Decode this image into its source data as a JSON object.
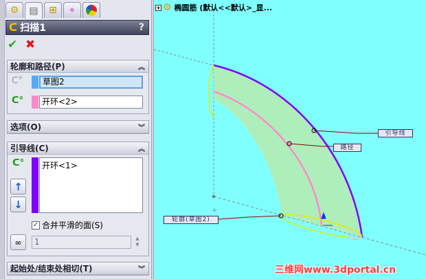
{
  "panel": {
    "tabs": [
      "feature-manager",
      "property-manager",
      "configuration-manager",
      "dimxpert-manager",
      "display-manager"
    ],
    "title": "扫描1",
    "help": "?",
    "ok_icon": "✔",
    "cancel_icon": "✖",
    "profile_path": {
      "header": "轮廓和路径(P)",
      "profile_value": "草图2",
      "path_value": "开环<2>",
      "profile_color": "#55aaff",
      "path_color": "#ff88cc"
    },
    "options": {
      "header": "选项(O)"
    },
    "guide": {
      "header": "引导线(C)",
      "items": [
        "开环<1>"
      ],
      "color": "#8000ff",
      "merge_label": "合并平滑的面(S)",
      "merge_checked": true,
      "spin_value": "1"
    },
    "tangency": {
      "header": "起始处/结束处相切(T)"
    }
  },
  "viewport": {
    "tree_item": "椭圆筋 (默认<<默认>_显...",
    "callouts": {
      "guide": "引导线",
      "path": "路径",
      "profile": "轮廓(草图2)"
    },
    "watermark": "三维网www.3dportal.cn"
  }
}
